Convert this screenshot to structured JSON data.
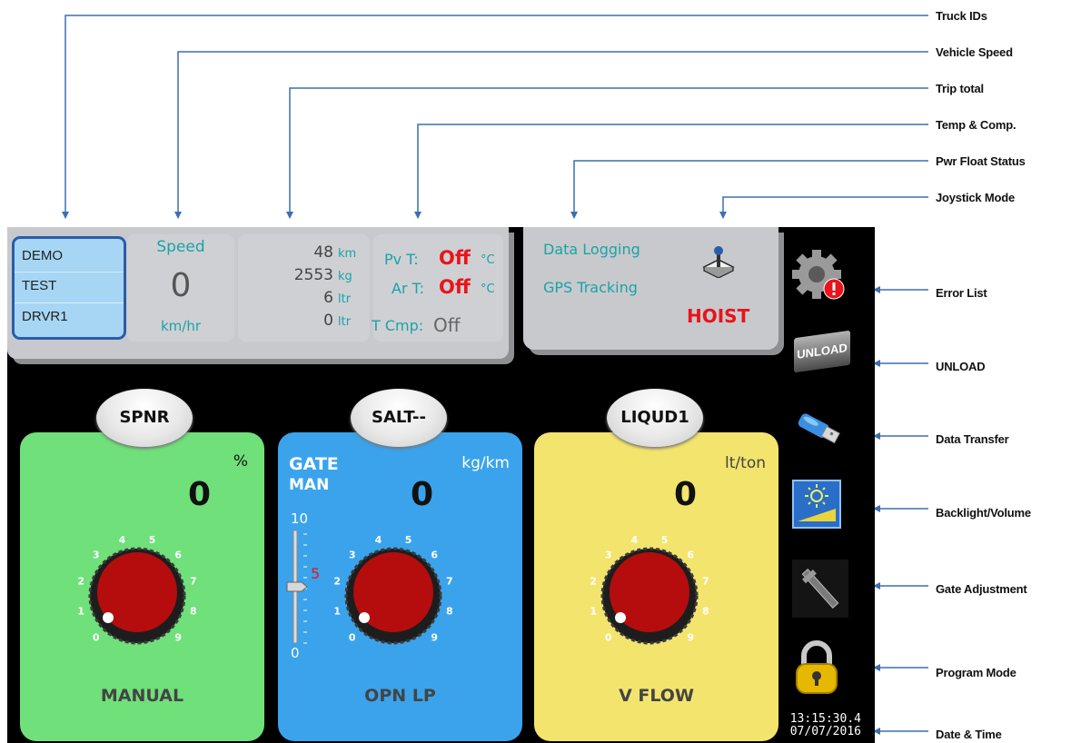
{
  "callouts": {
    "truck_ids": "Truck IDs",
    "vehicle_speed": "Vehicle Speed",
    "trip_total": "Trip total",
    "temp_comp": "Temp & Comp.",
    "pwr_float": "Pwr Float Status",
    "joystick": "Joystick Mode",
    "error_list": "Error List",
    "unload": "UNLOAD",
    "data_transfer": "Data Transfer",
    "backlight": "Backlight/Volume",
    "gate_adjust": "Gate Adjustment",
    "program_mode": "Program Mode",
    "date_time": "Date & Time"
  },
  "truck": {
    "id1": "DEMO",
    "id2": "TEST",
    "id3": "DRVR1"
  },
  "speed": {
    "label": "Speed",
    "value": "0",
    "unit": "km/hr"
  },
  "trip": {
    "distance": "48",
    "distance_unit": "km",
    "weight": "2553",
    "weight_unit": "kg",
    "liquid1": "6",
    "liquid1_unit": "ltr",
    "liquid2": "0",
    "liquid2_unit": "ltr"
  },
  "temp": {
    "pv_label": "Pv T:",
    "pv_value": "Off",
    "pv_unit": "°C",
    "ar_label": "Ar T:",
    "ar_value": "Off",
    "ar_unit": "°C",
    "tcmp_label": "T Cmp:",
    "tcmp_value": "Off"
  },
  "status": {
    "logging": "Data Logging",
    "gps": "GPS Tracking",
    "joystick_mode": "HOIST"
  },
  "sidebar": {
    "unload_label": "UNLOAD"
  },
  "panels": {
    "spinner": {
      "name": "SPNR",
      "unit": "%",
      "value": "0",
      "mode": "MANUAL"
    },
    "salt": {
      "name": "SALT--",
      "unit": "kg/km",
      "value": "0",
      "mode": "OPN LP",
      "gate_label": "GATE",
      "gate_mode": "MAN",
      "gate_max": "10",
      "gate_mid": "5",
      "gate_min": "0",
      "gate_level": 5
    },
    "liquid": {
      "name": "LIQUD1",
      "unit": "lt/ton",
      "value": "0",
      "mode": "V FLOW"
    }
  },
  "dial_scale": [
    "0",
    "1",
    "2",
    "3",
    "4",
    "5",
    "6",
    "7",
    "8",
    "9"
  ],
  "clock": {
    "time": "13:15:30.4",
    "date": "07/07/2016"
  },
  "colors": {
    "green_panel": "#6fe07a",
    "blue_panel": "#3aa3ec",
    "yellow_panel": "#f3e46e",
    "knob": "#b50d0d",
    "alert": "#e8141b",
    "accent_teal": "#19a3a8"
  }
}
